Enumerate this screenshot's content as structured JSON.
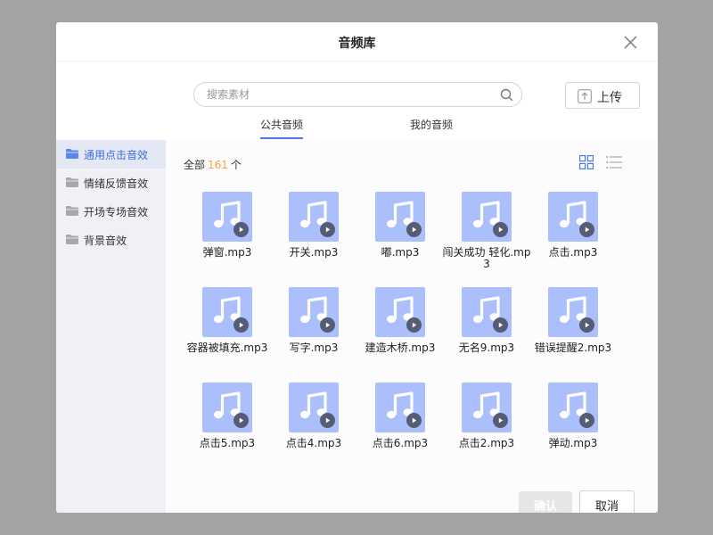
{
  "dialog": {
    "title": "音频库"
  },
  "search": {
    "placeholder": "搜索素材",
    "value": ""
  },
  "upload": {
    "label": "上传"
  },
  "tabs": [
    {
      "label": "公共音频",
      "active": true
    },
    {
      "label": "我的音频",
      "active": false
    }
  ],
  "sidebar": {
    "items": [
      {
        "label": "通用点击音效",
        "active": true
      },
      {
        "label": "情绪反馈音效",
        "active": false
      },
      {
        "label": "开场专场音效",
        "active": false
      },
      {
        "label": "背景音效",
        "active": false
      }
    ]
  },
  "content": {
    "count_prefix": "全部",
    "count_value": "161",
    "count_suffix": "个",
    "files": [
      {
        "name": "弹窗.mp3"
      },
      {
        "name": "开关.mp3"
      },
      {
        "name": "嘟.mp3"
      },
      {
        "name": "闯关成功 轻化.mp3"
      },
      {
        "name": "点击.mp3"
      },
      {
        "name": "容器被填充.mp3"
      },
      {
        "name": "写字.mp3"
      },
      {
        "name": "建造木桥.mp3"
      },
      {
        "name": "无名9.mp3"
      },
      {
        "name": "错误提醒2.mp3"
      },
      {
        "name": "点击5.mp3"
      },
      {
        "name": "点击4.mp3"
      },
      {
        "name": "点击6.mp3"
      },
      {
        "name": "点击2.mp3"
      },
      {
        "name": "弹动.mp3"
      }
    ]
  },
  "footer": {
    "confirm_label": "确认",
    "cancel_label": "取消"
  },
  "colors": {
    "accent": "#4a7be0",
    "count_highlight": "#f4a33d",
    "thumb_bg": "#aabffb",
    "play_badge": "#555d74"
  },
  "icons": {
    "close": "close-icon",
    "search": "search-icon",
    "upload": "upload-icon",
    "folder": "folder-icon",
    "grid_view": "grid-view-icon",
    "list_view": "list-view-icon",
    "music_note": "music-note-icon",
    "play": "play-icon"
  }
}
